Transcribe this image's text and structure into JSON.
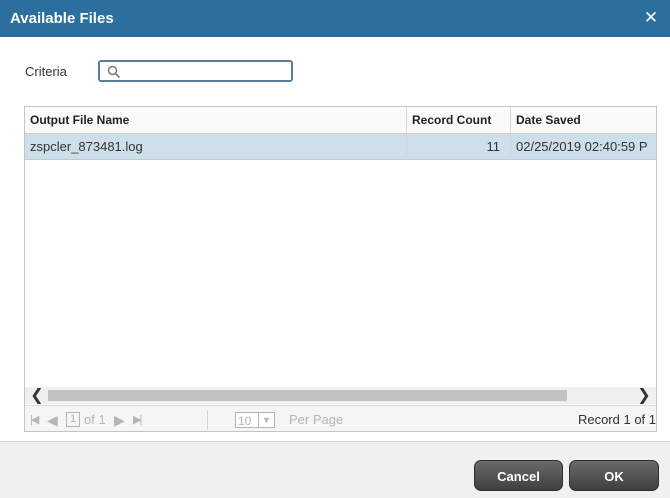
{
  "dialog": {
    "title": "Available Files",
    "close_glyph": "✕"
  },
  "criteria": {
    "label": "Criteria",
    "value": "",
    "placeholder": "",
    "icon": "search-icon"
  },
  "grid": {
    "columns": [
      "Output File Name",
      "Record Count",
      "Date Saved"
    ],
    "rows": [
      {
        "file_name": "zspcler_873481.log",
        "record_count": "11",
        "date_saved": "02/25/2019 02:40:59 P",
        "selected": true
      }
    ],
    "selected_row_color": "#cfdfea"
  },
  "pager": {
    "current_page": "1",
    "of_text": "of 1",
    "page_size": "10",
    "per_page_label": "Per Page",
    "record_info": "Record 1 of 1"
  },
  "buttons": {
    "cancel": "Cancel",
    "ok": "OK"
  },
  "colors": {
    "titlebar": "#2b6f9e",
    "button": "#4a4a4a"
  }
}
